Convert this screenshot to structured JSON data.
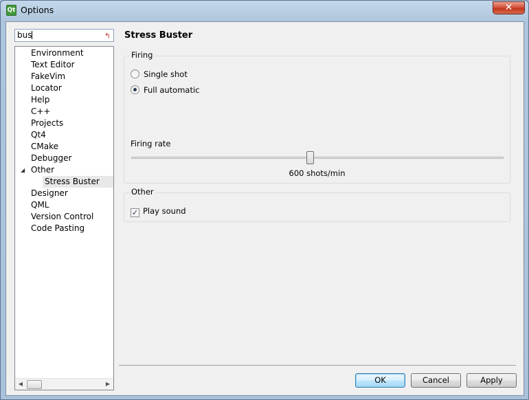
{
  "window": {
    "title": "Options",
    "app_icon_label": "Qt",
    "close_glyph": "✕"
  },
  "sidebar": {
    "search_value": "bus",
    "tree_items": [
      {
        "label": "Environment"
      },
      {
        "label": "Text Editor"
      },
      {
        "label": "FakeVim"
      },
      {
        "label": "Locator"
      },
      {
        "label": "Help"
      },
      {
        "label": "C++"
      },
      {
        "label": "Projects"
      },
      {
        "label": "Qt4"
      },
      {
        "label": "CMake"
      },
      {
        "label": "Debugger"
      },
      {
        "label": "Other",
        "expanded": true
      },
      {
        "label": "Stress Buster",
        "child": true,
        "selected": true
      },
      {
        "label": "Designer"
      },
      {
        "label": "QML"
      },
      {
        "label": "Version Control"
      },
      {
        "label": "Code Pasting"
      }
    ]
  },
  "page": {
    "title": "Stress Buster",
    "firing": {
      "group_title": "Firing",
      "single_shot_label": "Single shot",
      "single_shot_checked": false,
      "full_auto_label": "Full automatic",
      "full_auto_checked": true,
      "rate_label": "Firing rate",
      "rate_value_text": "600 shots/min",
      "slider_level": 0.48
    },
    "other": {
      "group_title": "Other",
      "play_sound_label": "Play sound",
      "play_sound_checked": true
    }
  },
  "buttons": {
    "ok": "OK",
    "cancel": "Cancel",
    "apply": "Apply"
  },
  "colors": {
    "titlebar": "#aec6dd",
    "close_button": "#c2391f",
    "default_button_border": "#3c7fb1"
  }
}
